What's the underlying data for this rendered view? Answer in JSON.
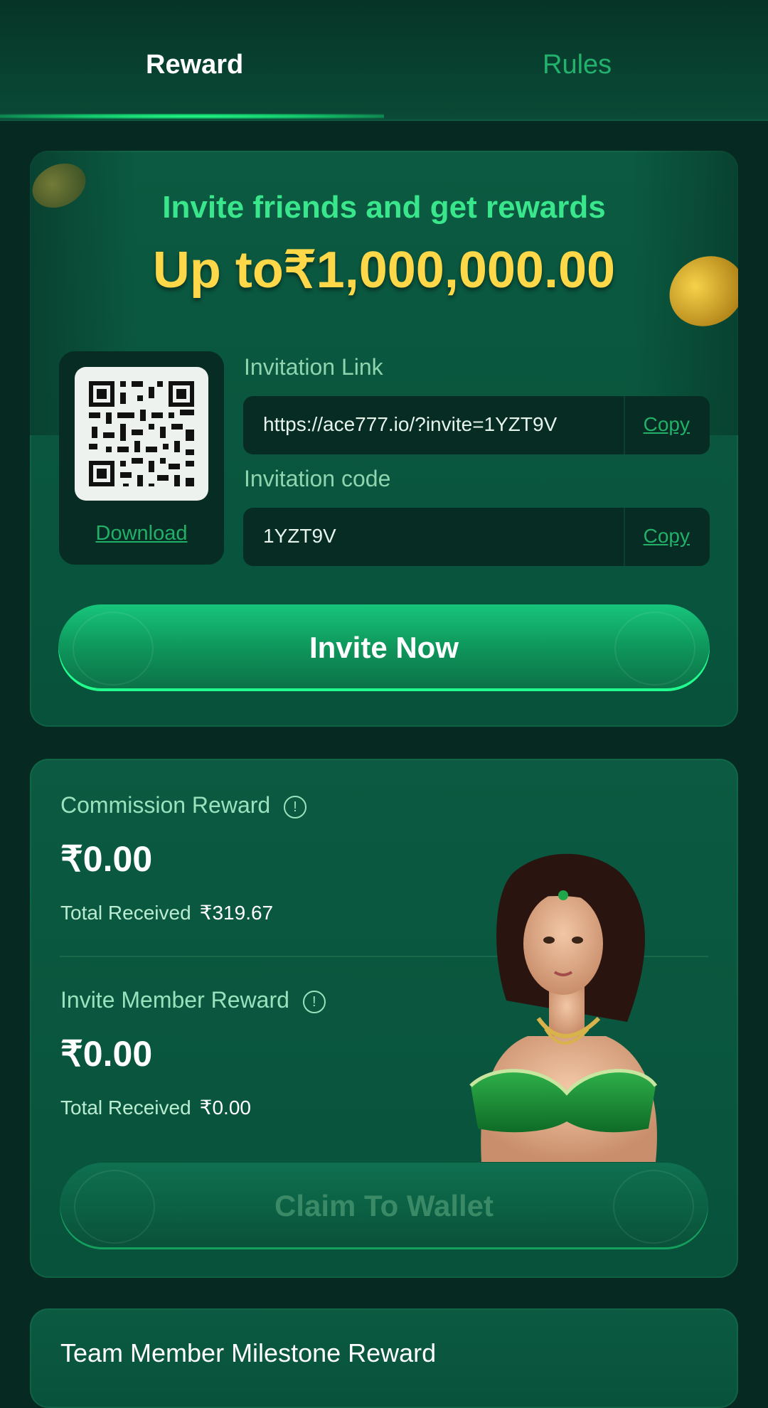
{
  "tabs": {
    "reward": "Reward",
    "rules": "Rules",
    "active": "reward"
  },
  "invite_card": {
    "title": "Invite friends and get rewards",
    "headline": "Up to₹1,000,000.00",
    "qr": {
      "download_label": "Download"
    },
    "invitation_link": {
      "label": "Invitation Link",
      "value": "https://ace777.io/?invite=1YZT9V",
      "copy_label": "Copy"
    },
    "invitation_code": {
      "label": "Invitation code",
      "value": "1YZT9V",
      "copy_label": "Copy"
    },
    "invite_button": "Invite Now"
  },
  "rewards_card": {
    "commission": {
      "label": "Commission Reward",
      "amount": "₹0.00",
      "received_label": "Total Received",
      "received_value": "₹319.67"
    },
    "invite_member": {
      "label": "Invite Member Reward",
      "amount": "₹0.00",
      "received_label": "Total Received",
      "received_value": "₹0.00"
    },
    "claim_button": "Claim To Wallet",
    "claim_enabled": false
  },
  "milestone_card": {
    "title": "Team Member Milestone Reward"
  },
  "colors": {
    "background": "#062a22",
    "card": "#0b5a41",
    "accent_green": "#22b068",
    "headline_gold": "#ffd84a",
    "title_green": "#3ae68c"
  },
  "icons": {
    "info": "info-circle-icon",
    "qr": "qr-code-icon"
  }
}
